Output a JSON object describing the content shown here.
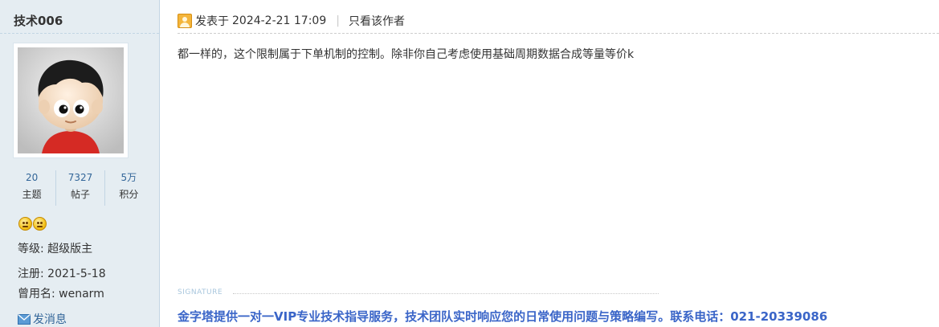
{
  "author": {
    "name": "技术006",
    "stats": [
      {
        "value": "20",
        "label": "主题"
      },
      {
        "value": "7327",
        "label": "帖子"
      },
      {
        "value": "5万",
        "label": "积分"
      }
    ],
    "level": "等级: 超级版主",
    "registered": "注册: 2021-5-18",
    "alias": "曾用名: wenarm",
    "send_message": "发消息",
    "medal_icons": [
      "smiley-medal-icon",
      "smiley-medal-icon"
    ],
    "colors": {
      "sidebar_bg": "#e5edf2",
      "link": "#336699"
    }
  },
  "post": {
    "posted_label": "发表于",
    "date": "2024-2-21 17:09",
    "only_author_label": "只看该作者",
    "body": "都一样的，这个限制属于下单机制的控制。除非你自己考虑使用基础周期数据合成等量等价k",
    "signature_label": "SIGNATURE",
    "signature": "金字塔提供一对一VIP专业技术指导服务，技术团队实时响应您的日常使用问题与策略编写。联系电话：021-20339086",
    "colors": {
      "signature": "#3a65c8"
    }
  }
}
